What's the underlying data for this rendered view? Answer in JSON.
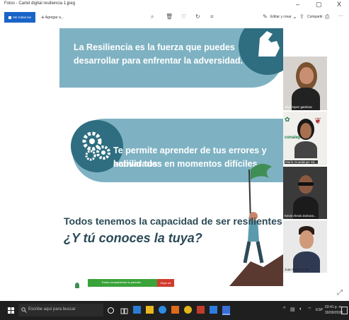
{
  "window": {
    "title": "Fotos - Cartel digital resiliencia 1.jpeg",
    "minimize": "–",
    "maximize": "▢",
    "close": "X"
  },
  "toolbar": {
    "view_all_label": "Ver todas las fotos",
    "add_label": "Agregar a...",
    "edit_create_label": "Editar y crear",
    "share_label": "Compartir",
    "more_label": "···"
  },
  "poster": {
    "line1": "La Resiliencia es la fuerza que puedes",
    "line2": "desarrollar para enfrentar la adversidad.",
    "line3": "Te permite aprender de tus errores y activar tus",
    "line4": "habilidades en momentos difíciles.",
    "line5": "Todos tenemos la capacidad de ser resilientes",
    "line6": "¿Y tú conoces la tuya?"
  },
  "share_bar": {
    "text": "Estás compartiendo la pantalla",
    "stop_label": "Dejar de"
  },
  "video_panel": {
    "participants": [
      {
        "name": "ailyn lopez gamboa"
      },
      {
        "name": "María Guadalupe Sá..."
      },
      {
        "name": "Kevin Alexis Zamora..."
      },
      {
        "name": "Juan Pablo G. M."
      }
    ],
    "logo_text": "conalep"
  },
  "taskbar": {
    "search_placeholder": "Escribe aquí para buscar",
    "language": "ESP",
    "time": "03:41 p. m.",
    "date": "30/09/2020"
  },
  "colors": {
    "accent": "#1a64c8",
    "banner": "#7eb2c2",
    "banner_dark": "#2e6e80",
    "title_text": "#2b4a56"
  }
}
